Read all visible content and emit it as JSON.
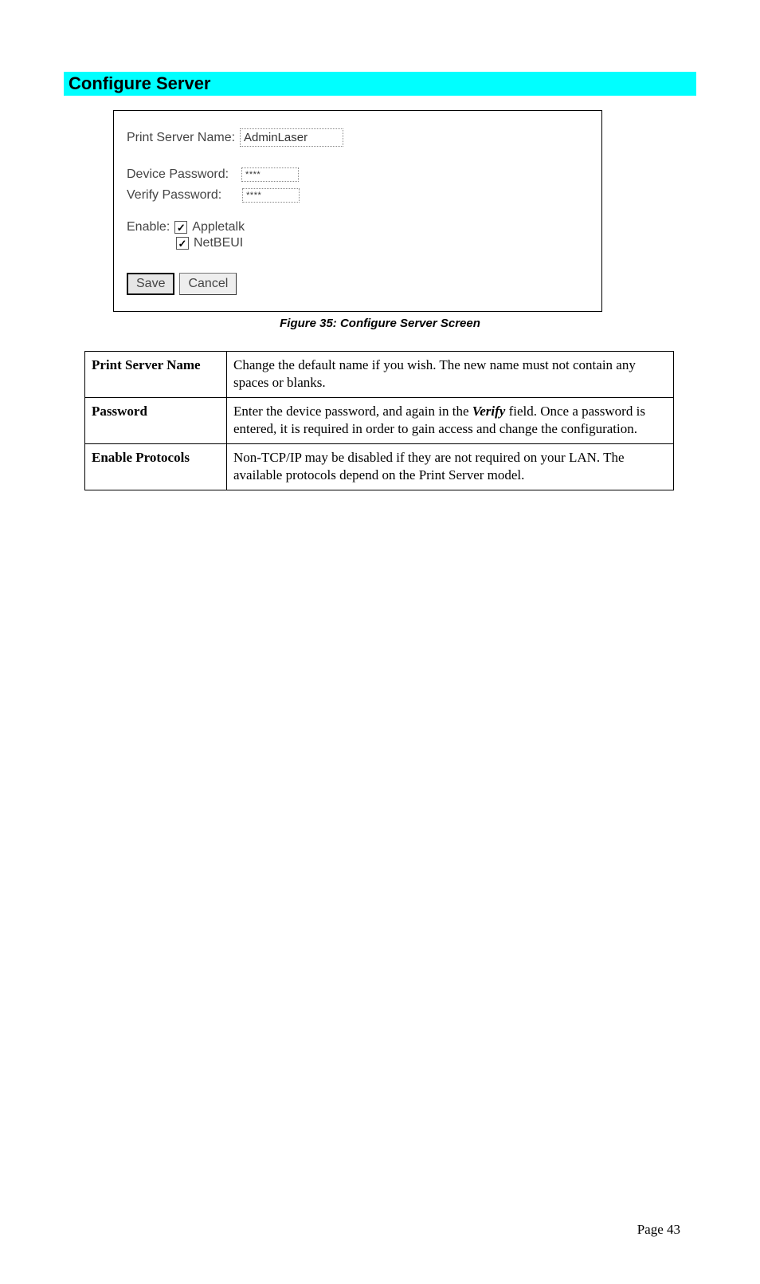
{
  "heading": "Configure Server",
  "screenshot": {
    "print_server_name_label": "Print Server Name:",
    "print_server_name_value": "AdminLaser",
    "device_password_label": "Device Password:",
    "device_password_value": "****",
    "verify_password_label": "Verify Password:",
    "verify_password_value": "****",
    "enable_label": "Enable:",
    "checkbox1_label": "Appletalk",
    "checkbox2_label": "NetBEUI",
    "save_btn": "Save",
    "cancel_btn": "Cancel"
  },
  "caption": "Figure 35: Configure Server Screen",
  "table": {
    "row1": {
      "label": "Print Server Name",
      "text": "Change the default name if you wish. The new name must not contain any spaces or blanks."
    },
    "row2": {
      "label": "Password",
      "text_before": "Enter the device password, and again in the ",
      "verify": "Verify",
      "text_after": " field. Once a password is entered, it is required in order to gain access and change the configuration."
    },
    "row3": {
      "label": "Enable Protocols",
      "text": "Non-TCP/IP may be disabled if they are not required on your LAN. The available protocols depend on the Print Server model."
    }
  },
  "page_number": "Page 43"
}
